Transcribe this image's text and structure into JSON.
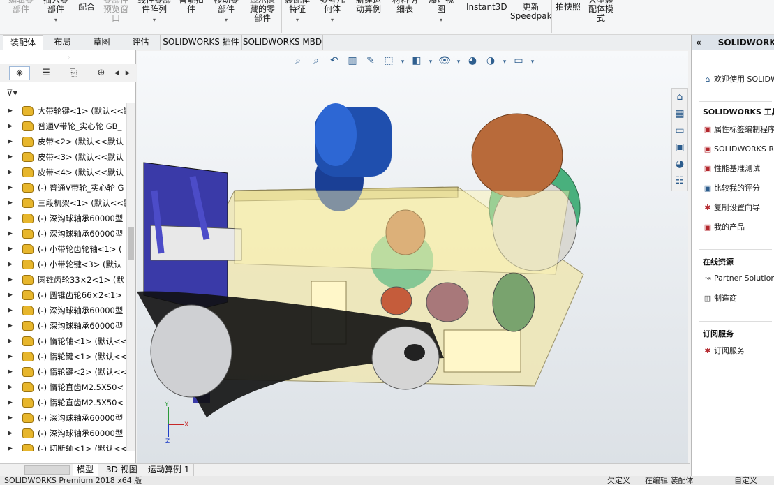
{
  "ribbon": {
    "b1": "编辑零\n部件",
    "b2": "插入零\n部件",
    "b3": "配合",
    "b4": "零部件\n预览窗\n口",
    "b5": "线性零部\n件阵列",
    "b6": "智能扣\n件",
    "b7": "移动零\n部件",
    "b8": "显示隐\n藏的零\n部件",
    "b9": "装配体\n特征",
    "b10": "参考几\n何体",
    "b11": "新建运\n动算例",
    "b12": "材料明\n细表",
    "b13": "爆炸视\n图",
    "b14": "Instant3D",
    "b15": "更新\nSpeedpak",
    "b16": "拍快照",
    "b17": "大型装\n配体模\n式"
  },
  "tabs": [
    "装配体",
    "布局",
    "草图",
    "评估",
    "SOLIDWORKS 插件",
    "SOLIDWORKS MBD"
  ],
  "tree": [
    "大带轮键<1> (默认<<默",
    "普通V带轮_实心轮 GB_",
    "皮带<2> (默认<<默认",
    "皮带<3> (默认<<默认",
    "皮带<4> (默认<<默认",
    "(-) 普通V带轮_实心轮 G",
    "三段机架<1> (默认<<默",
    "(-) 深沟球轴承60000型",
    "(-) 深沟球轴承60000型",
    "(-) 小带轮齿轮轴<1> (",
    "(-) 小带轮键<3> (默认",
    "圆锥齿轮33×2<1> (默",
    "(-) 圆锥齿轮66×2<1>",
    "(-) 深沟球轴承60000型",
    "(-) 深沟球轴承60000型",
    "(-) 惰轮轴<1> (默认<<",
    "(-) 惰轮键<1> (默认<<",
    "(-) 惰轮键<2> (默认<<",
    "(-) 惰轮直齿M2.5X50<",
    "(-) 惰轮直齿M2.5X50<",
    "(-) 深沟球轴承60000型",
    "(-) 深沟球轴承60000型",
    "(-) 切断轴<1> (默认<<"
  ],
  "bottom_tabs": [
    "模型",
    "3D 视图",
    "运动算例 1"
  ],
  "status": {
    "app": "SOLIDWORKS Premium 2018 x64 版",
    "s1": "欠定义",
    "s2": "在编辑 装配体",
    "s3": "自定义"
  },
  "rpanel": {
    "title": "SOLIDWORKS",
    "welcome": "欢迎使用 SOLIDWORKS",
    "tools_title": "SOLIDWORKS 工具",
    "tools": [
      "属性标签编制程序",
      "SOLIDWORKS Rx",
      "性能基准测试",
      "比较我的评分",
      "复制设置向导",
      "我的产品"
    ],
    "online_title": "在线资源",
    "online": [
      "Partner Solutions",
      "制造商"
    ],
    "sub_title": "订阅服务",
    "sub": [
      "订阅服务"
    ]
  },
  "triad": {
    "x": "X",
    "y": "Y",
    "z": "Z"
  },
  "colors": {
    "motor": "#1f4fae",
    "gear": "#b86a3a",
    "green": "#49b07d",
    "frame": "#e9dfa0",
    "belt": "#1b1b1b",
    "bracket": "#3a3aa8"
  }
}
